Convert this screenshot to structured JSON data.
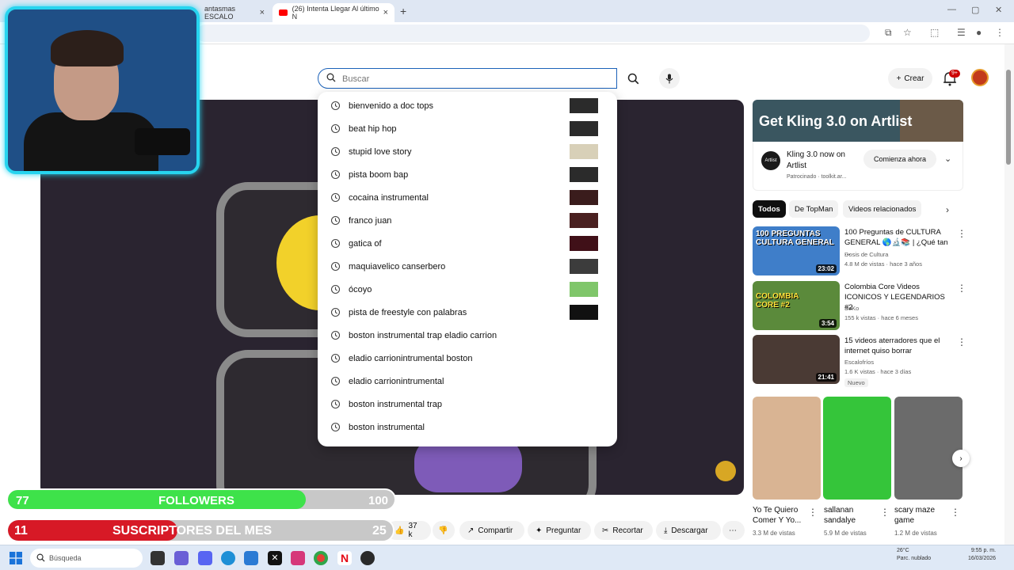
{
  "browser": {
    "tabs": [
      {
        "label": "antasmas ESCALO"
      },
      {
        "label": "(26) Intenta Llegar Al último N"
      }
    ],
    "new_tab": "+"
  },
  "search": {
    "placeholder": "Buscar",
    "suggestions": [
      "bienvenido a doc tops",
      "beat hip hop",
      "stupid love story",
      "pista boom bap",
      "cocaina instrumental",
      "franco juan",
      "gatica of",
      "maquiavelico canserbero",
      "ócoyo",
      "pista de freestyle con palabras",
      "boston instrumental trap eladio carrion",
      "eladio carrionintrumental boston",
      "eladio carrionintrumental",
      "boston instrumental trap",
      "boston instrumental"
    ]
  },
  "header": {
    "create_label": "Crear",
    "notif_badge": "9+"
  },
  "ad": {
    "banner_title": "Get Kling 3.0 on Artlist",
    "logo_text": "Artlist",
    "text": "Kling 3.0 now on Artlist",
    "sponsor": "Patrocinado · toolkit.ar...",
    "cta": "Comienza ahora"
  },
  "chips": [
    "Todos",
    "De TopMan",
    "Videos relacionados"
  ],
  "related": [
    {
      "title": "100 Preguntas de CULTURA GENERAL 🌎🔬📚 | ¿Qué tan ...",
      "channel": "Dosis de Cultura",
      "meta": "4.8 M de vistas · hace 3 años",
      "duration": "23:02",
      "thumb_text": "100 PREGUNTAS CULTURA GENERAL"
    },
    {
      "title": "Colombia Core Videos ICONICOS Y LEGENDARIOS #2",
      "channel": "SeKo",
      "meta": "155 k vistas · hace 6 meses",
      "duration": "3:54",
      "thumb_text": "COLOMBIA CORE #2"
    },
    {
      "title": "15 videos aterradores que el internet quiso borrar",
      "channel": "Escalofríos",
      "meta": "1.6 K vistas · hace 3 días",
      "duration": "21:41",
      "badge": "Nuevo"
    }
  ],
  "shorts": [
    {
      "title": "Yo Te Quiero Comer Y Yo...",
      "views": "3.3 M de vistas"
    },
    {
      "title": "sallanan sandalye",
      "views": "5.9 M de vistas"
    },
    {
      "title": "scary maze game",
      "views": "1.2 M de vistas"
    }
  ],
  "actions": {
    "likes": "37 k",
    "share": "Compartir",
    "ask": "Preguntar",
    "clip": "Recortar",
    "download": "Descargar"
  },
  "overlay": {
    "followers": {
      "count": "77",
      "label": "FOLLOWERS",
      "goal": "100",
      "progress": 0.77
    },
    "subs": {
      "count": "11",
      "label": "SUSCRIPTORES DEL MES",
      "goal": "25",
      "progress": 0.44
    }
  },
  "taskbar": {
    "search_label": "Búsqueda",
    "weather_temp": "26°C",
    "weather_desc": "Parc. nublado",
    "time": "9:55 p. m.",
    "date": "16/03/2026"
  },
  "colors": {
    "youtube_red": "#ff0000",
    "follower_green": "#3ee24a",
    "subs_red": "#d71926",
    "webcam_cyan": "#27d4ef"
  }
}
